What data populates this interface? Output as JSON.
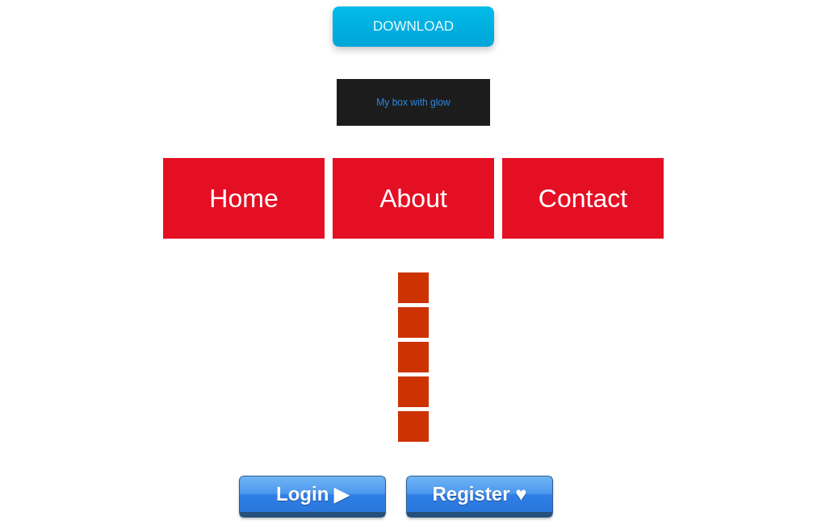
{
  "download_button": {
    "label": "DOWNLOAD"
  },
  "glow_box": {
    "text": "My box with glow"
  },
  "nav": {
    "items": [
      {
        "label": "Home"
      },
      {
        "label": "About"
      },
      {
        "label": "Contact"
      }
    ]
  },
  "buttons": [
    {
      "label": "Login ▶"
    },
    {
      "label": "Register ♥"
    }
  ]
}
